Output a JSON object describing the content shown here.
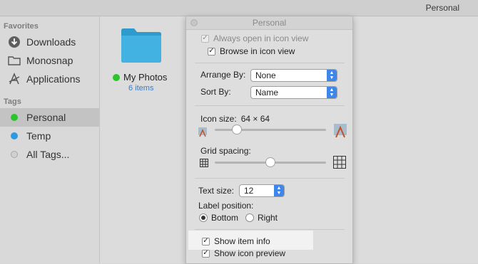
{
  "window": {
    "title": "Personal"
  },
  "sidebar": {
    "favorites_heading": "Favorites",
    "favorites": [
      {
        "label": "Downloads",
        "icon": "download-circle-icon"
      },
      {
        "label": "Monosnap",
        "icon": "folder-icon"
      },
      {
        "label": "Applications",
        "icon": "applications-icon"
      }
    ],
    "tags_heading": "Tags",
    "tags": [
      {
        "label": "Personal",
        "color": "#2cc42c",
        "selected": true
      },
      {
        "label": "Temp",
        "color": "#2f98e0",
        "selected": false
      },
      {
        "label": "All Tags...",
        "color": "#d0d0d0",
        "selected": false
      }
    ]
  },
  "content": {
    "folder": {
      "name": "My Photos",
      "count": "6 items",
      "tag_color": "#2cc42c",
      "folder_color": "#3aaad8"
    }
  },
  "panel": {
    "title": "Personal",
    "always_open_icon_view": {
      "label": "Always open in icon view",
      "checked": true,
      "enabled": false
    },
    "browse_icon_view": {
      "label": "Browse in icon view",
      "checked": true
    },
    "arrange_by": {
      "label": "Arrange By:",
      "value": "None"
    },
    "sort_by": {
      "label": "Sort By:",
      "value": "Name"
    },
    "icon_size": {
      "label": "Icon size:",
      "value": "64 × 64",
      "level": 0.2
    },
    "grid_spacing": {
      "label": "Grid spacing:",
      "level": 0.5
    },
    "text_size": {
      "label": "Text size:",
      "value": "12"
    },
    "label_position": {
      "label": "Label position:",
      "options": [
        "Bottom",
        "Right"
      ],
      "selected": "Bottom"
    },
    "show_item_info": {
      "label": "Show item info",
      "checked": true
    },
    "show_icon_preview": {
      "label": "Show icon preview",
      "checked": true
    }
  }
}
